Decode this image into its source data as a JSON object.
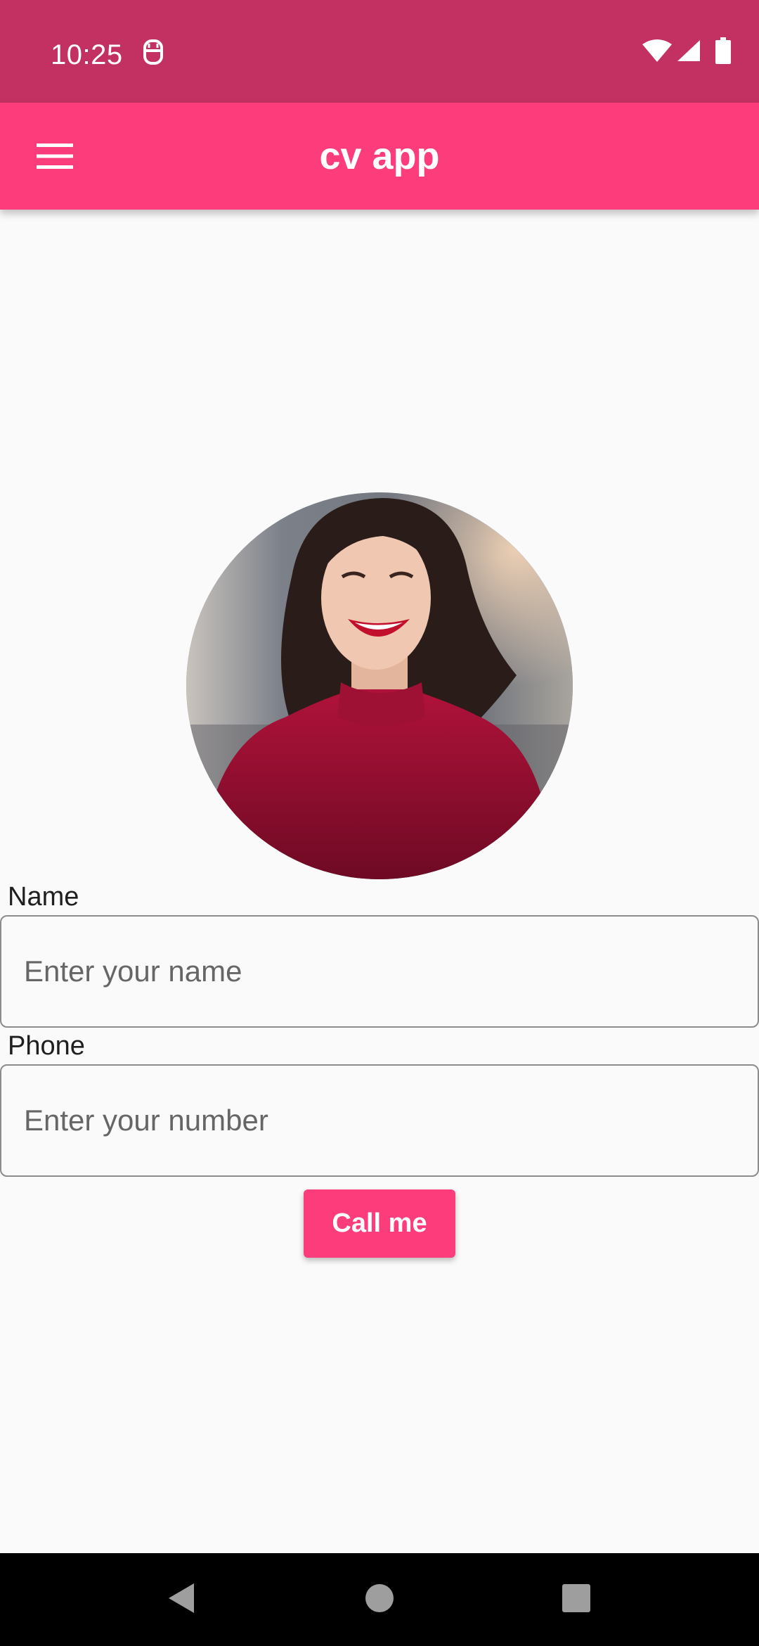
{
  "status_bar": {
    "time": "10:25",
    "icons": [
      "notification-icon",
      "wifi-icon",
      "signal-icon",
      "battery-icon"
    ]
  },
  "app_bar": {
    "title": "cv app",
    "menu_icon": "menu-icon"
  },
  "profile": {
    "avatar": "profile-photo"
  },
  "form": {
    "name_label": "Name",
    "name_placeholder": "Enter your name",
    "name_value": "",
    "phone_label": "Phone",
    "phone_placeholder": "Enter your number",
    "phone_value": "",
    "call_button_label": "Call me"
  },
  "nav_bar": {
    "icons": [
      "back-icon",
      "home-icon",
      "recents-icon"
    ]
  },
  "colors": {
    "status_bar": "#c23162",
    "app_bar": "#fd3c7c",
    "accent": "#fd3c7c",
    "background": "#fafafa",
    "nav_bar": "#000000"
  }
}
